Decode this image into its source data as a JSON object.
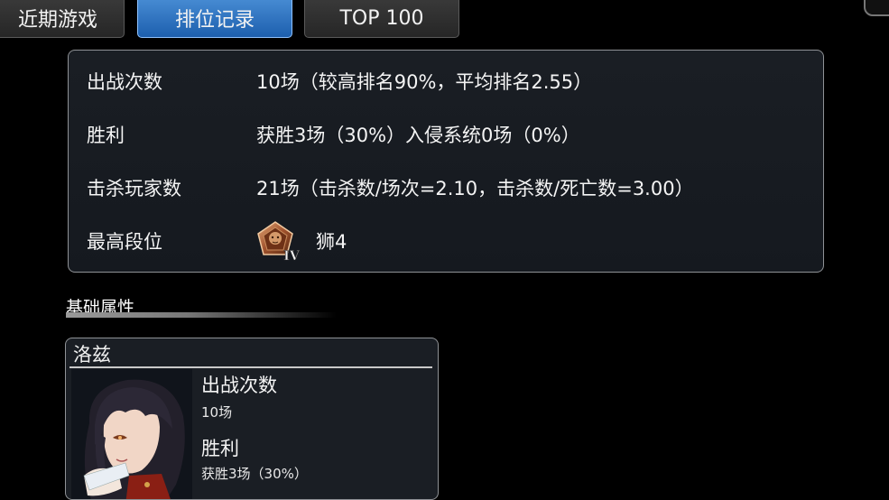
{
  "tabs": [
    {
      "label": "近期游戏",
      "active": false
    },
    {
      "label": "排位记录",
      "active": true
    },
    {
      "label": "TOP 100",
      "active": false
    }
  ],
  "stats": {
    "battles_label": "出战次数",
    "battles_value": "10场（较高排名90%，平均排名2.55）",
    "wins_label": "胜利",
    "wins_value": "获胜3场（30%）入侵系统0场（0%）",
    "kills_label": "击杀玩家数",
    "kills_value": "21场（击杀数/场次=2.10，击杀数/死亡数=3.00）",
    "rank_label": "最高段位",
    "rank_badge_numeral": "IV",
    "rank_value": "狮4"
  },
  "section": {
    "title": "基础属性"
  },
  "character": {
    "name": "洛兹",
    "battles_label": "出战次数",
    "battles_value": "10场",
    "wins_label": "胜利",
    "wins_value": "获胜3场（30%）"
  },
  "icons": {
    "rank_badge": "lion-rank-badge-icon",
    "portrait": "character-portrait"
  },
  "colors": {
    "active_tab": "#2f76c4",
    "rank_badge": "#a0522d"
  }
}
